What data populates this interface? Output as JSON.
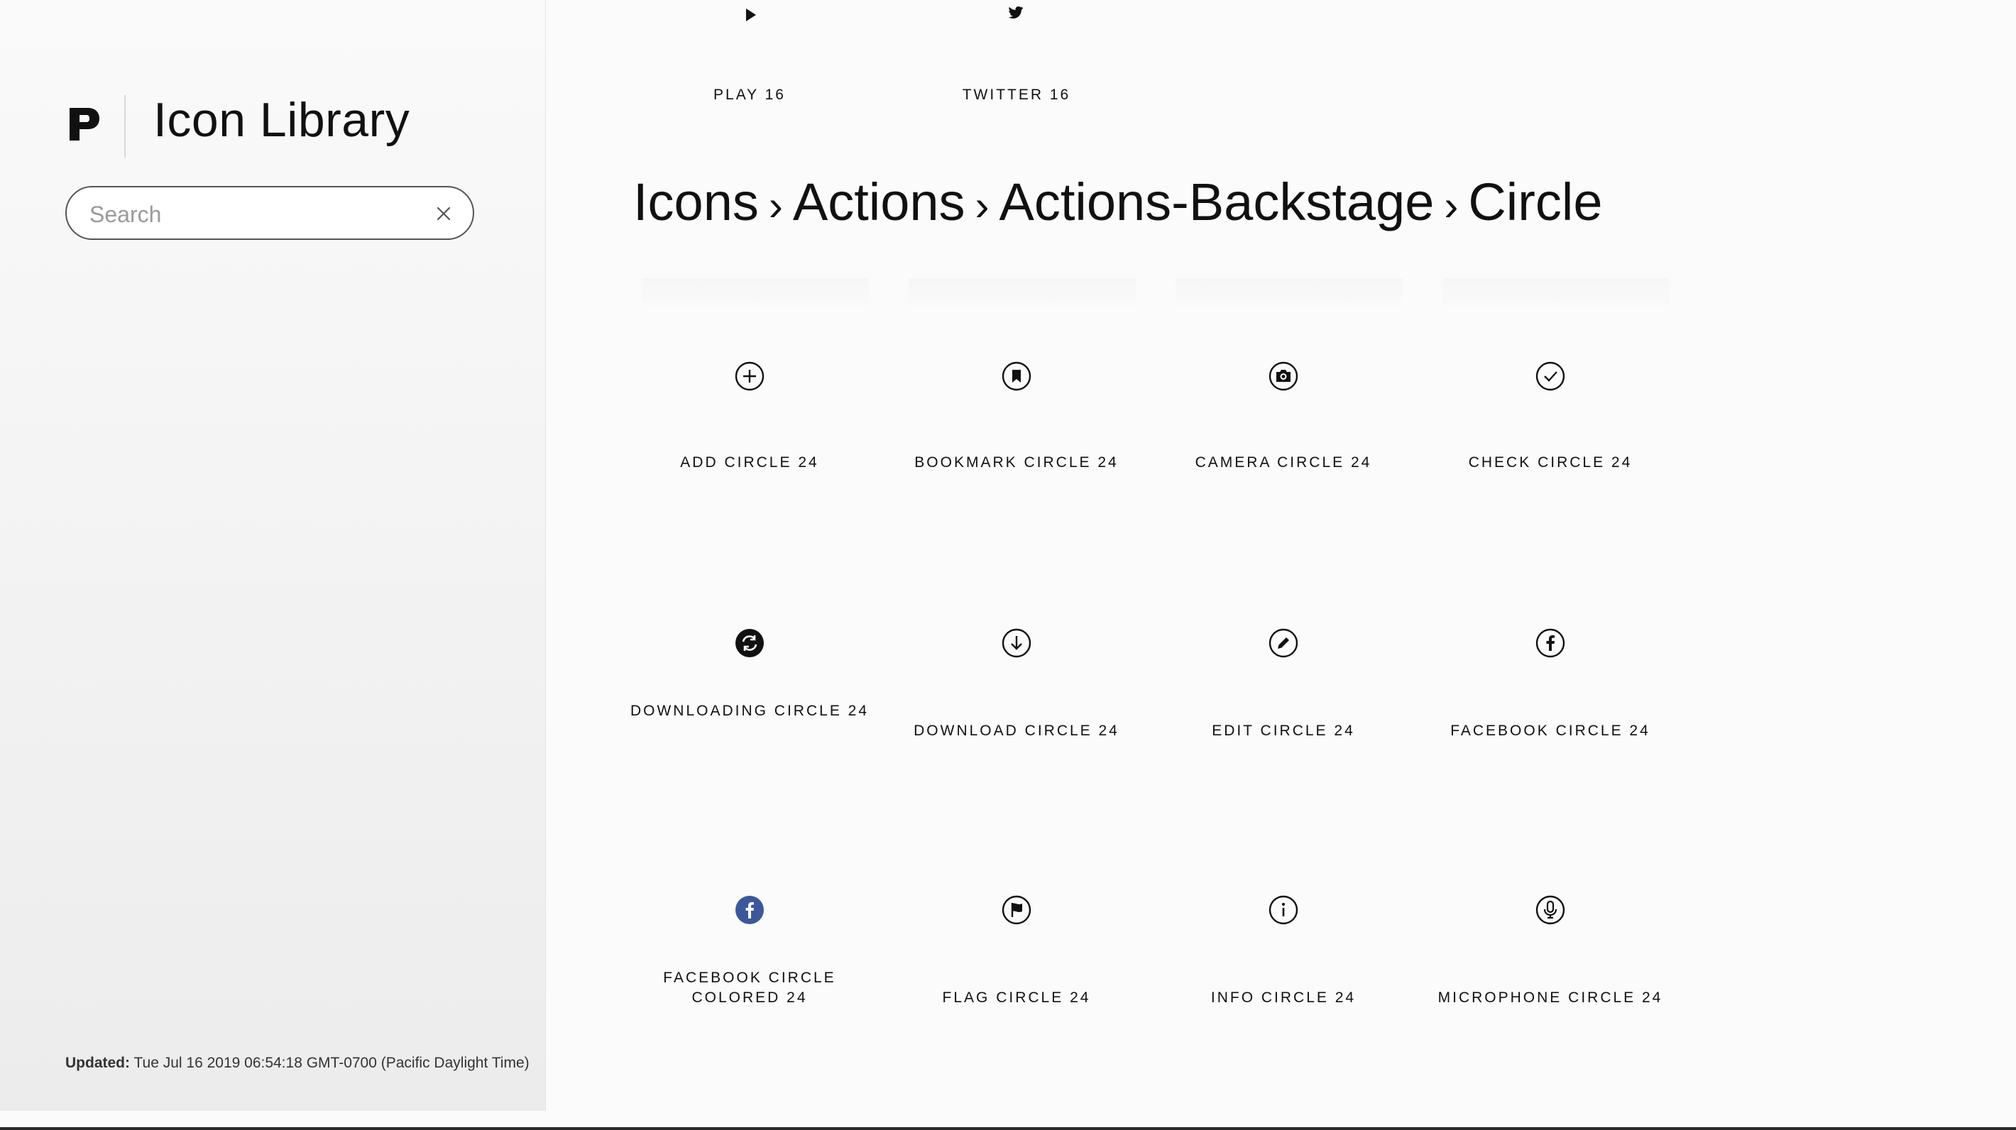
{
  "sidebar": {
    "title": "Icon Library",
    "search": {
      "placeholder": "Search",
      "value": ""
    },
    "updated_label": "Updated:",
    "updated_value": "Tue Jul 16 2019 06:54:18 GMT-0700 (Pacific Daylight Time)"
  },
  "top_icons": [
    {
      "label": "PLAY 16",
      "icon": "play-icon"
    },
    {
      "label": "TWITTER 16",
      "icon": "twitter-icon"
    }
  ],
  "breadcrumb": {
    "items": [
      "Icons",
      "Actions",
      "Actions-Backstage",
      "Circle"
    ],
    "separator": "›"
  },
  "icons": [
    {
      "label": "ADD CIRCLE 24",
      "icon": "add-circle-icon"
    },
    {
      "label": "BOOKMARK CIRCLE 24",
      "icon": "bookmark-circle-icon"
    },
    {
      "label": "CAMERA CIRCLE 24",
      "icon": "camera-circle-icon"
    },
    {
      "label": "CHECK CIRCLE 24",
      "icon": "check-circle-icon"
    },
    {
      "label": "DOWNLOADING CIRCLE 24",
      "icon": "downloading-circle-icon"
    },
    {
      "label": "DOWNLOAD CIRCLE 24",
      "icon": "download-circle-icon"
    },
    {
      "label": "EDIT CIRCLE 24",
      "icon": "edit-circle-icon"
    },
    {
      "label": "FACEBOOK CIRCLE 24",
      "icon": "facebook-circle-icon"
    },
    {
      "label": "FACEBOOK CIRCLE COLORED 24",
      "icon": "facebook-circle-colored-icon",
      "color": "#3b5998"
    },
    {
      "label": "FLAG CIRCLE 24",
      "icon": "flag-circle-icon"
    },
    {
      "label": "INFO CIRCLE 24",
      "icon": "info-circle-icon"
    },
    {
      "label": "MICROPHONE CIRCLE 24",
      "icon": "microphone-circle-icon"
    }
  ]
}
